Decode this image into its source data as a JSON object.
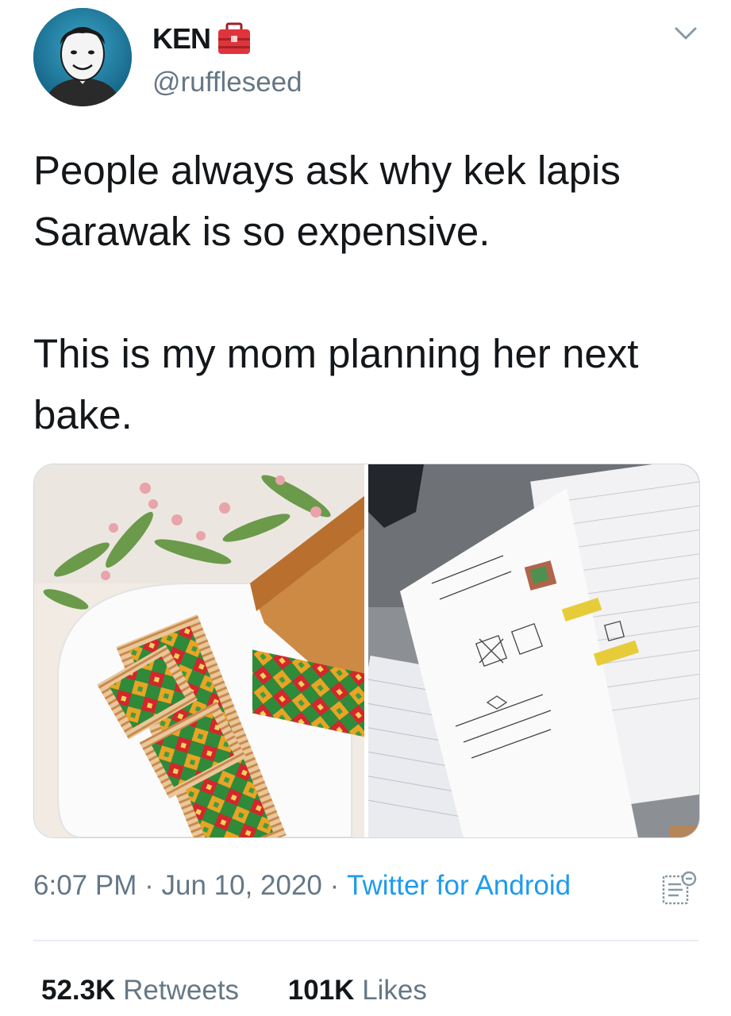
{
  "user": {
    "display_name": "KEN",
    "handle": "@ruffleseed"
  },
  "tweet": {
    "paragraphs": [
      "People always ask why kek lapis Sarawak is so expensive.",
      "This is my mom planning her next bake."
    ]
  },
  "meta": {
    "time": "6:07 PM",
    "separator1": "·",
    "date": "Jun 10, 2020",
    "separator2": "·",
    "source": "Twitter for Android"
  },
  "stats": {
    "retweets_count": "52.3K",
    "retweets_label": "Retweets",
    "likes_count": "101K",
    "likes_label": "Likes"
  },
  "icons": {
    "toolbox": "toolbox-emoji-icon",
    "more": "chevron-down-icon",
    "analytics": "analytics-icon"
  },
  "colors": {
    "link": "#1d9bf0",
    "secondary_text": "#657786",
    "toolbox_red": "#e0343c"
  }
}
